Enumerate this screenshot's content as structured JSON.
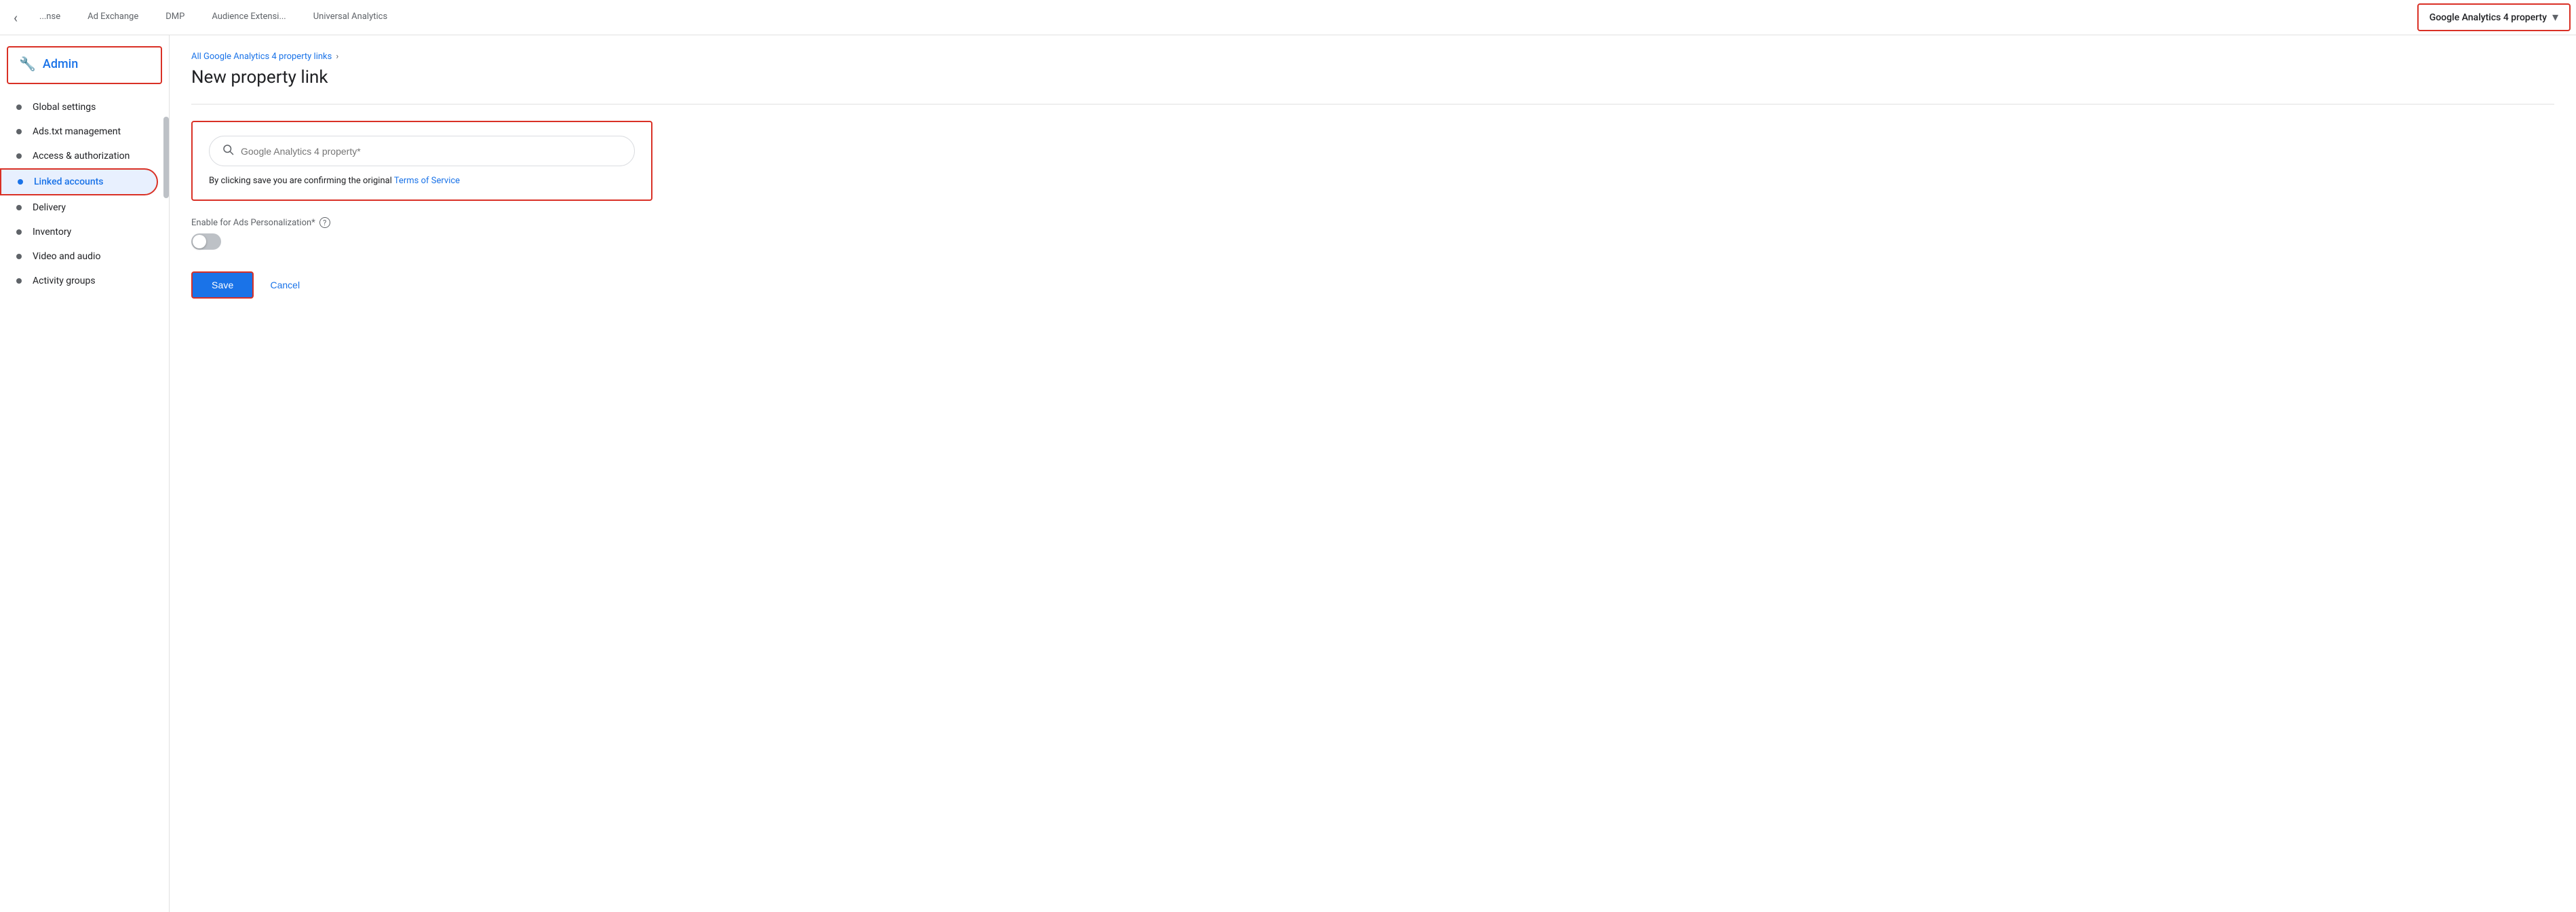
{
  "topNav": {
    "backIcon": "‹",
    "tabs": [
      {
        "label": "...nse",
        "active": false
      },
      {
        "label": "Ad Exchange",
        "active": false
      },
      {
        "label": "DMP",
        "active": false
      },
      {
        "label": "Audience Extensi...",
        "active": false
      },
      {
        "label": "Universal Analytics",
        "active": false
      }
    ],
    "dropdown": {
      "label": "Google Analytics 4 property",
      "chevron": "▾"
    }
  },
  "sidebar": {
    "adminLabel": "Admin",
    "items": [
      {
        "label": "Global settings",
        "active": false
      },
      {
        "label": "Ads.txt management",
        "active": false
      },
      {
        "label": "Access & authorization",
        "active": false
      },
      {
        "label": "Linked accounts",
        "active": true
      },
      {
        "label": "Delivery",
        "active": false
      },
      {
        "label": "Inventory",
        "active": false
      },
      {
        "label": "Video and audio",
        "active": false
      },
      {
        "label": "Activity groups",
        "active": false
      }
    ]
  },
  "breadcrumb": {
    "linkText": "All Google Analytics 4 property links",
    "separator": "›"
  },
  "pageTitle": "New property link",
  "searchSection": {
    "placeholder": "Google Analytics 4 property*",
    "tosText": "By clicking save you are confirming the original ",
    "tosLinkText": "Terms of Service"
  },
  "toggleSection": {
    "label": "Enable for Ads Personalization*",
    "helpIcon": "?",
    "enabled": false
  },
  "actions": {
    "saveLabel": "Save",
    "cancelLabel": "Cancel"
  }
}
